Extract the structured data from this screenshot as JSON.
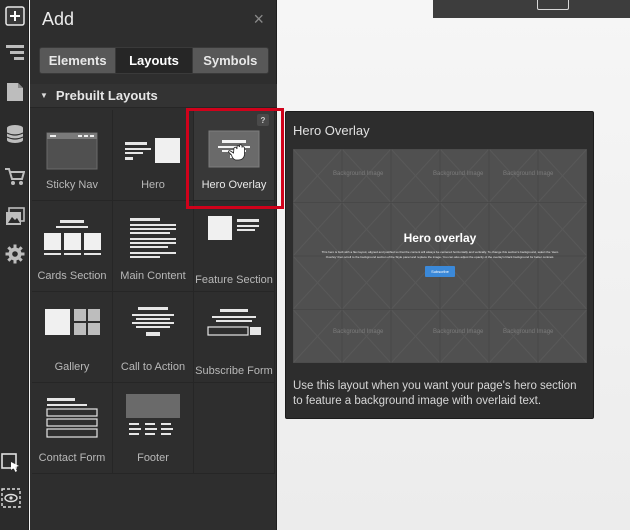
{
  "panel": {
    "title": "Add",
    "close_icon": "×",
    "tabs": [
      {
        "label": "Elements"
      },
      {
        "label": "Layouts"
      },
      {
        "label": "Symbols"
      }
    ],
    "section_title": "Prebuilt Layouts",
    "layouts": [
      {
        "label": "Sticky Nav",
        "icon": "sticky-nav-thumbnail"
      },
      {
        "label": "Hero",
        "icon": "hero-thumbnail"
      },
      {
        "label": "Hero Overlay",
        "icon": "hero-overlay-thumbnail",
        "help": "?"
      },
      {
        "label": "Cards Section",
        "icon": "cards-section-thumbnail"
      },
      {
        "label": "Main Content",
        "icon": "main-content-thumbnail"
      },
      {
        "label": "Feature Section",
        "icon": "feature-section-thumbnail"
      },
      {
        "label": "Gallery",
        "icon": "gallery-thumbnail"
      },
      {
        "label": "Call to Action",
        "icon": "call-to-action-thumbnail"
      },
      {
        "label": "Subscribe Form",
        "icon": "subscribe-form-thumbnail"
      },
      {
        "label": "Contact Form",
        "icon": "contact-form-thumbnail"
      },
      {
        "label": "Footer",
        "icon": "footer-thumbnail"
      }
    ]
  },
  "preview": {
    "title": "Hero Overlay",
    "overlay_heading": "Hero overlay",
    "overlay_body": "This hero is built with a flex layout, aligned and justified so that the content will always be centered horizontally and vertically. To change this section's background, select the 'Hero Overlay' then scroll to the background section of the Style panel and replace the image. You can also adjust the opacity of the overlay's black background for better contrast.",
    "overlay_button": "Subscribe",
    "placeholder_tile": "Background Image",
    "description": "Use this layout when you want your page's hero section to feature a background image with overlaid text."
  },
  "colors": {
    "accent_highlight": "#d0021b",
    "overlay_button": "#3b89d9"
  }
}
